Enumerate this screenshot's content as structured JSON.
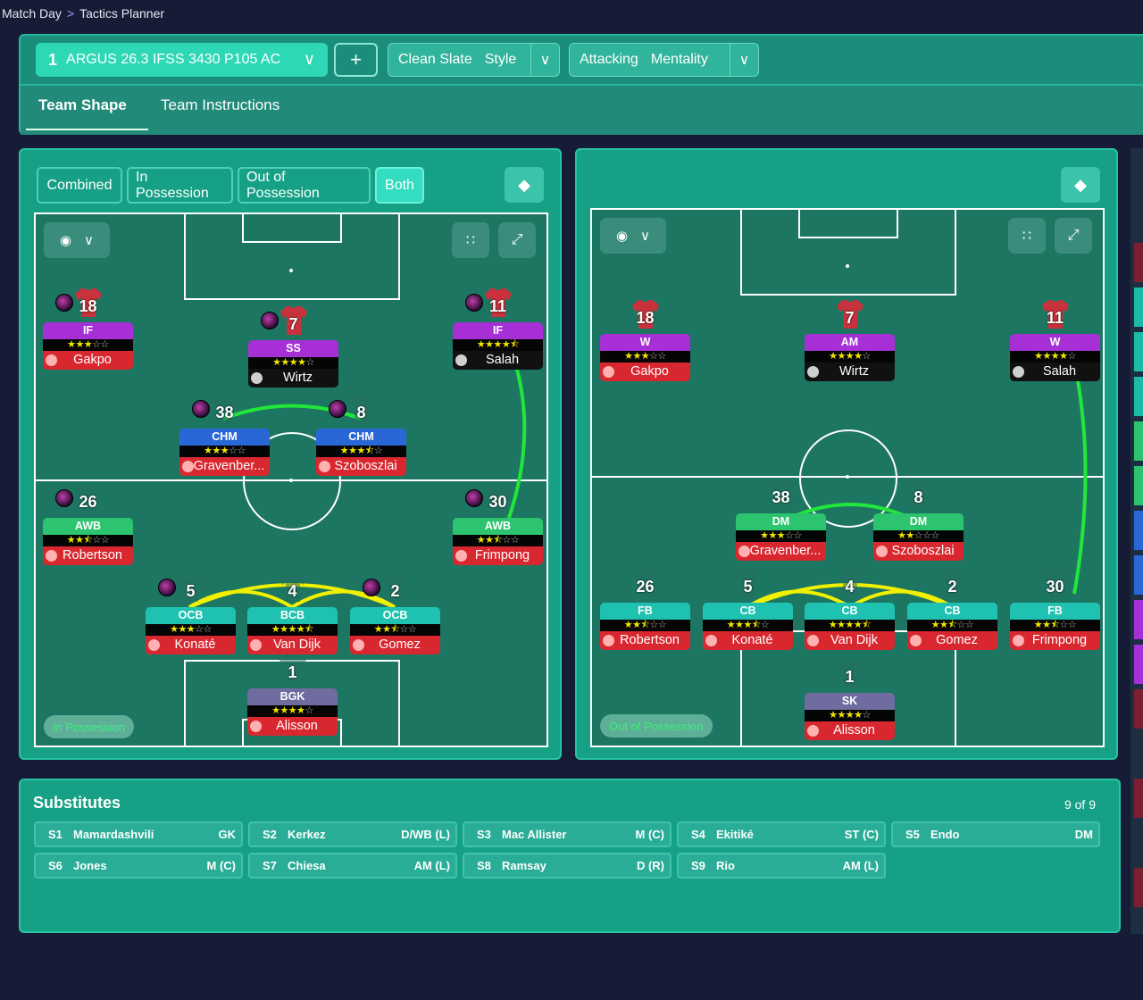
{
  "breadcrumb": {
    "root": "Match Day",
    "sep": ">",
    "current": "Tactics Planner"
  },
  "toolbar": {
    "tactic_number": "1",
    "tactic_name": "ARGUS 26.3 IFSS 3430 P105 AC",
    "add_label": "+",
    "style_value": "Clean Slate",
    "style_label": "Style",
    "mentality_value": "Attacking",
    "mentality_label": "Mentality"
  },
  "tabs": [
    {
      "label": "Team Shape"
    },
    {
      "label": "Team Instructions"
    }
  ],
  "left_panel": {
    "modes": [
      {
        "label": "Combined"
      },
      {
        "label": "In Possession"
      },
      {
        "label": "Out of Possession"
      },
      {
        "label": "Both"
      }
    ],
    "phase_label": "In Possession",
    "players": [
      {
        "num": "18",
        "role": "IF",
        "name": "Gakpo",
        "stars": 3,
        "role_color": "#a62fd6",
        "name_bg": "#d8272f"
      },
      {
        "num": "7",
        "role": "SS",
        "name": "Wirtz",
        "stars": 4,
        "role_color": "#a62fd6",
        "name_bg": "#111"
      },
      {
        "num": "11",
        "role": "IF",
        "name": "Salah",
        "stars": 4.5,
        "role_color": "#a62fd6",
        "name_bg": "#111"
      },
      {
        "num": "38",
        "role": "CHM",
        "name": "Gravenber...",
        "stars": 3,
        "role_color": "#2a67d6",
        "name_bg": "#d8272f"
      },
      {
        "num": "8",
        "role": "CHM",
        "name": "Szoboszlai",
        "stars": 3.5,
        "role_color": "#2a67d6",
        "name_bg": "#d8272f"
      },
      {
        "num": "26",
        "role": "AWB",
        "name": "Robertson",
        "stars": 2.5,
        "role_color": "#2cc46e",
        "name_bg": "#d8272f"
      },
      {
        "num": "30",
        "role": "AWB",
        "name": "Frimpong",
        "stars": 2.5,
        "role_color": "#2cc46e",
        "name_bg": "#d8272f"
      },
      {
        "num": "5",
        "role": "OCB",
        "name": "Konaté",
        "stars": 3,
        "role_color": "#1fc2b0",
        "name_bg": "#d8272f"
      },
      {
        "num": "4",
        "role": "BCB",
        "name": "Van Dijk",
        "stars": 4.5,
        "role_color": "#1fc2b0",
        "name_bg": "#d8272f"
      },
      {
        "num": "2",
        "role": "OCB",
        "name": "Gomez",
        "stars": 2.5,
        "role_color": "#1fc2b0",
        "name_bg": "#d8272f"
      },
      {
        "num": "1",
        "role": "BGK",
        "name": "Alisson",
        "stars": 4,
        "role_color": "#6f6ca0",
        "name_bg": "#d8272f"
      }
    ]
  },
  "right_panel": {
    "phase_label": "Out of Possession",
    "players": [
      {
        "num": "18",
        "role": "W",
        "name": "Gakpo",
        "stars": 3,
        "role_color": "#a62fd6",
        "name_bg": "#d8272f"
      },
      {
        "num": "7",
        "role": "AM",
        "name": "Wirtz",
        "stars": 4,
        "role_color": "#a62fd6",
        "name_bg": "#111"
      },
      {
        "num": "11",
        "role": "W",
        "name": "Salah",
        "stars": 4,
        "role_color": "#a62fd6",
        "name_bg": "#111"
      },
      {
        "num": "38",
        "role": "DM",
        "name": "Gravenber...",
        "stars": 3,
        "role_color": "#2cc46e",
        "name_bg": "#d8272f"
      },
      {
        "num": "8",
        "role": "DM",
        "name": "Szoboszlai",
        "stars": 2,
        "role_color": "#2cc46e",
        "name_bg": "#d8272f"
      },
      {
        "num": "26",
        "role": "FB",
        "name": "Robertson",
        "stars": 2.5,
        "role_color": "#1fc2b0",
        "name_bg": "#d8272f"
      },
      {
        "num": "5",
        "role": "CB",
        "name": "Konaté",
        "stars": 3.5,
        "role_color": "#1fc2b0",
        "name_bg": "#d8272f"
      },
      {
        "num": "4",
        "role": "CB",
        "name": "Van Dijk",
        "stars": 4.5,
        "role_color": "#1fc2b0",
        "name_bg": "#d8272f"
      },
      {
        "num": "2",
        "role": "CB",
        "name": "Gomez",
        "stars": 2.5,
        "role_color": "#1fc2b0",
        "name_bg": "#d8272f"
      },
      {
        "num": "30",
        "role": "FB",
        "name": "Frimpong",
        "stars": 2.5,
        "role_color": "#1fc2b0",
        "name_bg": "#d8272f"
      },
      {
        "num": "1",
        "role": "SK",
        "name": "Alisson",
        "stars": 4,
        "role_color": "#6f6ca0",
        "name_bg": "#d8272f"
      }
    ]
  },
  "substitutes": {
    "title": "Substitutes",
    "count": "9 of 9",
    "items": [
      {
        "id": "S1",
        "name": "Mamardashvili",
        "pos": "GK"
      },
      {
        "id": "S2",
        "name": "Kerkez",
        "pos": "D/WB (L)"
      },
      {
        "id": "S3",
        "name": "Mac Allister",
        "pos": "M (C)"
      },
      {
        "id": "S4",
        "name": "Ekitiké",
        "pos": "ST (C)"
      },
      {
        "id": "S5",
        "name": "Endo",
        "pos": "DM"
      },
      {
        "id": "S6",
        "name": "Jones",
        "pos": "M (C)"
      },
      {
        "id": "S7",
        "name": "Chiesa",
        "pos": "AM (L)"
      },
      {
        "id": "S8",
        "name": "Ramsay",
        "pos": "D (R)"
      },
      {
        "id": "S9",
        "name": "Rio",
        "pos": "AM (L)"
      }
    ]
  }
}
